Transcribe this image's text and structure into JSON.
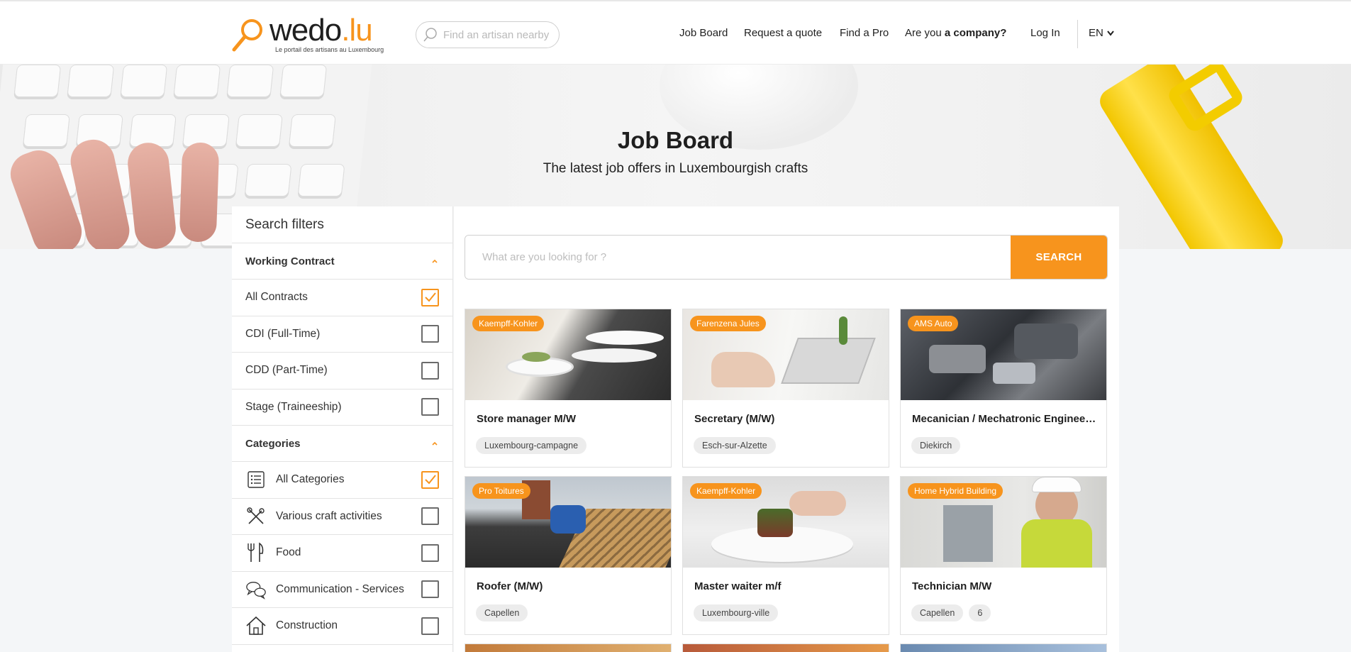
{
  "header": {
    "logo_text": "wedo",
    "logo_tld": ".lu",
    "logo_tagline": "Le portail des artisans au Luxembourg",
    "search_placeholder": "Find an artisan nearby",
    "nav": {
      "job_board": "Job Board",
      "request_quote": "Request a quote",
      "find_pro": "Find a Pro",
      "company_prefix": "Are you",
      "company_bold": "a company?",
      "login": "Log In",
      "language": "EN"
    }
  },
  "hero": {
    "title": "Job Board",
    "subtitle": "The latest job offers in Luxembourgish crafts"
  },
  "filters": {
    "title": "Search filters",
    "contract_section": "Working Contract",
    "contracts": [
      {
        "label": "All Contracts",
        "checked": true
      },
      {
        "label": "CDI (Full-Time)",
        "checked": false
      },
      {
        "label": "CDD (Part-Time)",
        "checked": false
      },
      {
        "label": "Stage (Traineeship)",
        "checked": false
      }
    ],
    "categories_section": "Categories",
    "categories": [
      {
        "label": "All Categories",
        "icon": "list-icon",
        "checked": true
      },
      {
        "label": "Various craft activities",
        "icon": "tools-icon",
        "checked": false
      },
      {
        "label": "Food",
        "icon": "fork-knife-icon",
        "checked": false
      },
      {
        "label": "Communication - Services",
        "icon": "chat-bubbles-icon",
        "checked": false
      },
      {
        "label": "Construction",
        "icon": "house-icon",
        "checked": false
      }
    ]
  },
  "search": {
    "placeholder": "What are you looking for ?",
    "button": "SEARCH"
  },
  "jobs": [
    {
      "company": "Kaempff-Kohler",
      "title": "Store manager M/W",
      "tags": [
        "Luxembourg-campagne"
      ],
      "image": "waiter-plates"
    },
    {
      "company": "Farenzena Jules",
      "title": "Secretary (M/W)",
      "tags": [
        "Esch-sur-Alzette"
      ],
      "image": "laptop-desk"
    },
    {
      "company": "AMS Auto",
      "title": "Mecanician / Mechatronic Engineer (...",
      "tags": [
        "Diekirch"
      ],
      "image": "car-engine"
    },
    {
      "company": "Pro Toitures",
      "title": "Roofer (M/W)",
      "tags": [
        "Capellen"
      ],
      "image": "roof"
    },
    {
      "company": "Kaempff-Kohler",
      "title": "Master waiter m/f",
      "tags": [
        "Luxembourg-ville"
      ],
      "image": "plated-dish"
    },
    {
      "company": "Home Hybrid Building",
      "title": "Technician M/W",
      "tags": [
        "Capellen",
        "6"
      ],
      "image": "electrician"
    }
  ],
  "colors": {
    "accent": "#f7941d",
    "text": "#1f1f1f",
    "page_bg": "#f4f6f8"
  }
}
